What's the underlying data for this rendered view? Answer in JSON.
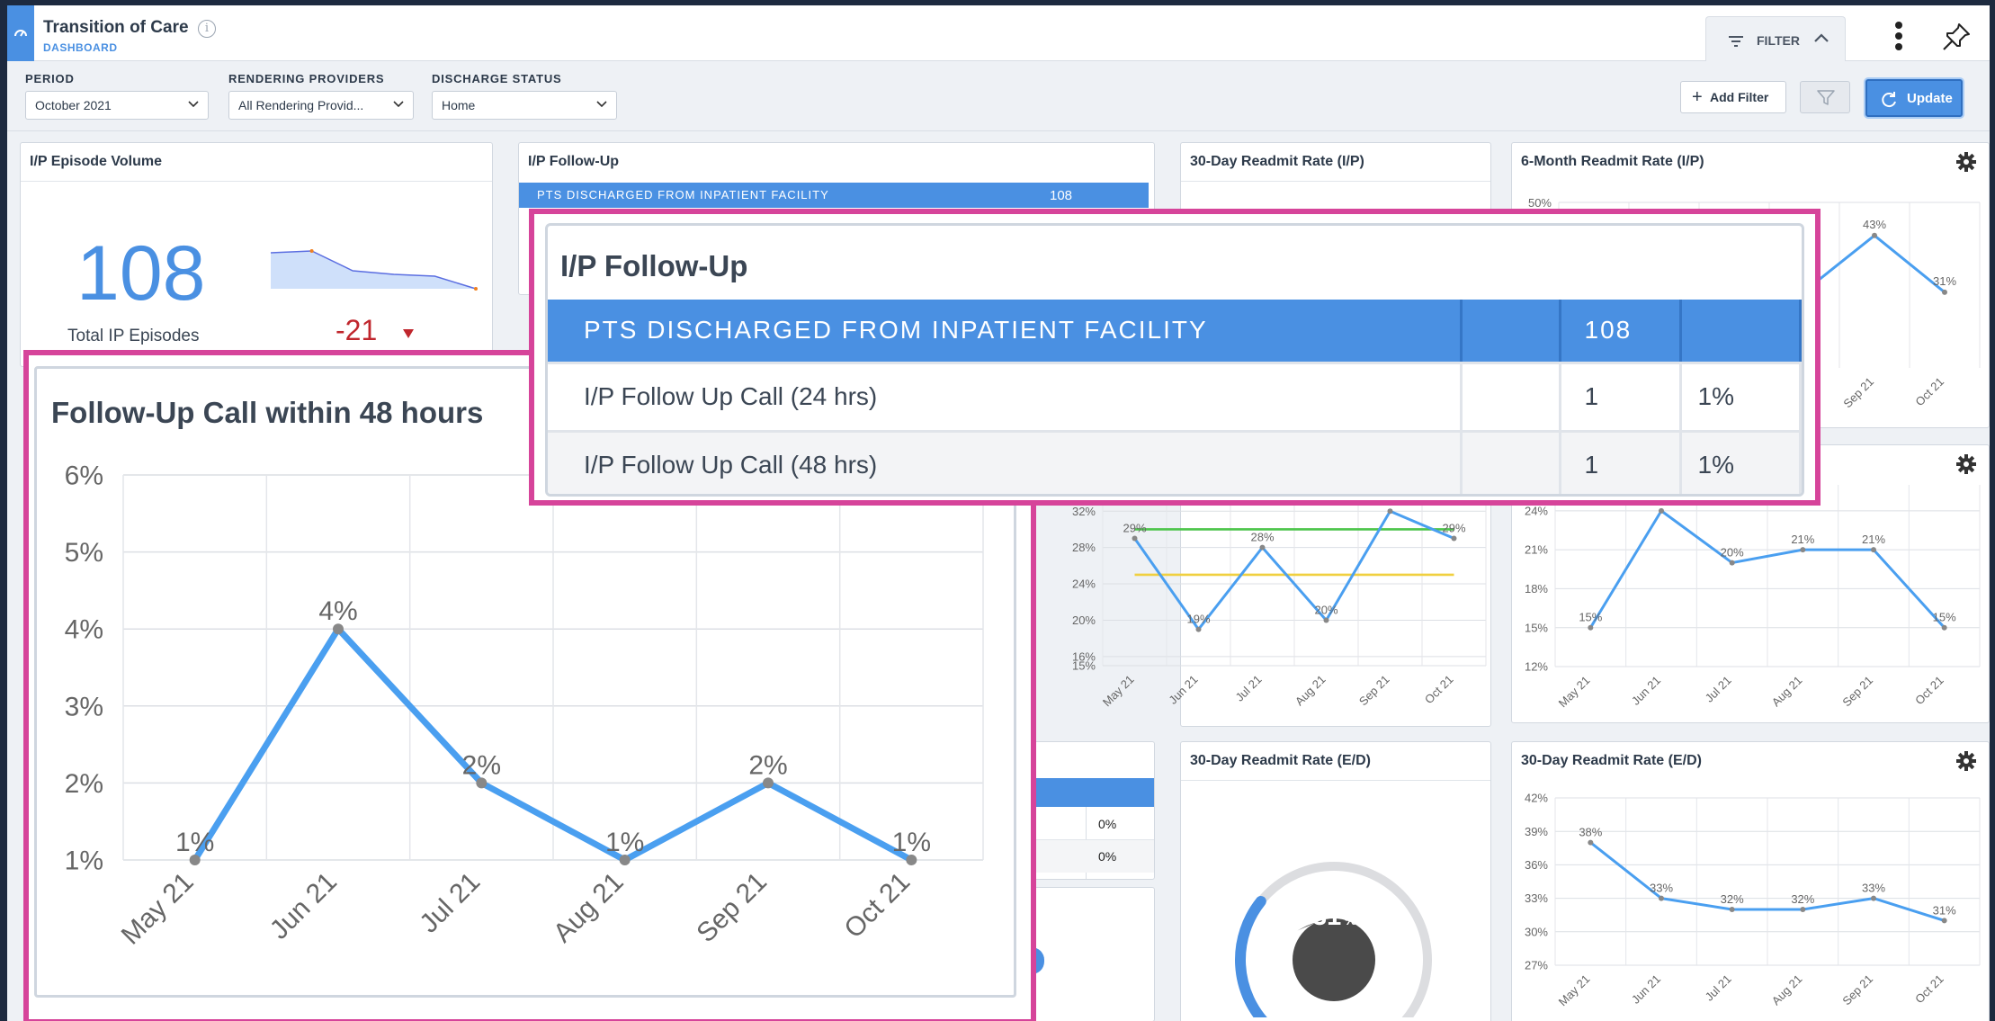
{
  "header": {
    "title": "Transition of Care",
    "subtitle": "DASHBOARD",
    "filter_label": "FILTER"
  },
  "filters": {
    "period": {
      "label": "PERIOD",
      "value": "October 2021"
    },
    "providers": {
      "label": "RENDERING PROVIDERS",
      "value": "All Rendering Provid..."
    },
    "discharge": {
      "label": "DISCHARGE STATUS",
      "value": "Home"
    },
    "add_filter": "Add Filter",
    "update": "Update"
  },
  "cards": {
    "episode_volume": {
      "title": "I/P Episode Volume",
      "value": "108",
      "caption": "Total IP Episodes",
      "delta": "-21"
    },
    "followup_small": {
      "title": "I/P Follow-Up",
      "header_row": "PTS DISCHARGED FROM INPATIENT FACILITY",
      "header_value": "108"
    },
    "readmit30_ip": {
      "title": "30-Day Readmit Rate (I/P)"
    },
    "readmit6m_ip": {
      "title": "6-Month Readmit Rate (I/P)"
    },
    "readmit30_ed": {
      "title": "30-Day Readmit Rate (E/D)",
      "gauge_value": "31",
      "gauge_unit": "%"
    },
    "readmit30_ed_trend": {
      "title": "30-Day Readmit Rate (E/D)"
    },
    "partial_table": {
      "rows": [
        "0%",
        "0%"
      ]
    },
    "partial_card_suffix": ")"
  },
  "zoom_followup": {
    "title": "I/P Follow-Up",
    "rows": [
      {
        "label": "PTS DISCHARGED FROM INPATIENT FACILITY",
        "blank": "",
        "count": "108",
        "pct": ""
      },
      {
        "label": "I/P Follow Up Call (24 hrs)",
        "blank": "",
        "count": "1",
        "pct": "1%"
      },
      {
        "label": "I/P Follow Up Call (48 hrs)",
        "blank": "",
        "count": "1",
        "pct": "1%"
      }
    ]
  },
  "chart_data": [
    {
      "id": "followup48",
      "type": "line",
      "title": "Follow-Up Call within 48 hours",
      "categories": [
        "May 21",
        "Jun 21",
        "Jul 21",
        "Aug 21",
        "Sep 21",
        "Oct 21"
      ],
      "series": [
        {
          "values": [
            1,
            4,
            2,
            1,
            2,
            1
          ]
        }
      ],
      "data_labels": [
        "1%",
        "4%",
        "2%",
        "1%",
        "2%",
        "1%"
      ],
      "y_ticks": [
        "1%",
        "2%",
        "3%",
        "4%",
        "5%",
        "6%"
      ],
      "ylim": [
        1,
        6
      ],
      "color": "#4a9ff0"
    },
    {
      "id": "readmit6m_top",
      "type": "line",
      "title": "6-Month Readmit Rate (I/P)",
      "categories": [
        "Sep 21",
        "Oct 21"
      ],
      "series": [
        {
          "values": [
            43,
            31
          ]
        }
      ],
      "data_labels": [
        "43%",
        "31%"
      ],
      "y_ticks": [
        "50%"
      ],
      "color": "#4a9ff0"
    },
    {
      "id": "readmit30_trend_mid",
      "type": "line",
      "categories": [
        "May 21",
        "Jun 21",
        "Jul 21",
        "Aug 21",
        "Sep 21",
        "Oct 21"
      ],
      "series": [
        {
          "values": [
            29,
            19,
            28,
            20,
            32,
            29
          ]
        }
      ],
      "data_labels": [
        "29%",
        "19%",
        "28%",
        "20%",
        "32%",
        "29%"
      ],
      "y_ticks": [
        "15%",
        "16%",
        "20%",
        "24%",
        "28%",
        "32%"
      ],
      "ylim": [
        15,
        34
      ],
      "reference_lines": [
        {
          "value": 30,
          "color": "#4cc44a"
        },
        {
          "value": 25,
          "color": "#f0d040"
        }
      ],
      "color": "#4a9ff0"
    },
    {
      "id": "readmit_right_mid",
      "type": "line",
      "categories": [
        "May 21",
        "Jun 21",
        "Jul 21",
        "Aug 21",
        "Sep 21",
        "Oct 21"
      ],
      "series": [
        {
          "values": [
            15,
            24,
            20,
            21,
            21,
            15
          ]
        }
      ],
      "data_labels": [
        "15%",
        "24%",
        "20%",
        "21%",
        "21%",
        "15%"
      ],
      "y_ticks": [
        "12%",
        "15%",
        "18%",
        "21%",
        "24%"
      ],
      "ylim": [
        12,
        26
      ],
      "color": "#4a9ff0"
    },
    {
      "id": "readmit30_ed_trend",
      "type": "line",
      "title": "30-Day Readmit Rate (E/D)",
      "categories": [
        "May 21",
        "Jun 21",
        "Jul 21",
        "Aug 21",
        "Sep 21",
        "Oct 21"
      ],
      "series": [
        {
          "values": [
            38,
            33,
            32,
            32,
            33,
            31
          ]
        }
      ],
      "data_labels": [
        "38%",
        "33%",
        "32%",
        "32%",
        "33%",
        "31%"
      ],
      "y_ticks": [
        "27%",
        "30%",
        "33%",
        "36%",
        "39%",
        "42%"
      ],
      "ylim": [
        27,
        42
      ],
      "color": "#4a9ff0"
    },
    {
      "id": "episode_spark",
      "type": "area",
      "series": [
        {
          "values": [
            128,
            129,
            118,
            116,
            115,
            108
          ]
        }
      ],
      "color": "#4a9ff0"
    },
    {
      "id": "readmit30_gauge",
      "type": "gauge",
      "value": 31,
      "max": 100,
      "color": "#4a90e2"
    }
  ]
}
